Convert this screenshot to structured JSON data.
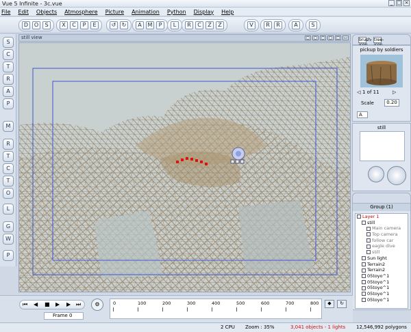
{
  "window": {
    "title": "Vue 5 Infinite - 3c.vue",
    "controls": [
      "_",
      "□",
      "×"
    ]
  },
  "menu": [
    "File",
    "Edit",
    "Objects",
    "Atmosphere",
    "Picture",
    "Animation",
    "Python",
    "Display",
    "Help"
  ],
  "toolbar": {
    "groups": [
      [
        "D",
        "O",
        "S"
      ],
      [
        "X",
        "C",
        "P",
        "E"
      ],
      [
        "↺",
        "↻"
      ],
      [
        "A",
        "M",
        "P"
      ],
      [
        "L"
      ],
      [
        "R",
        "C",
        "Z",
        "Z"
      ],
      [
        "V"
      ],
      [
        "R",
        "R"
      ],
      [
        "A"
      ],
      [
        "S"
      ]
    ]
  },
  "left_tools": [
    "S",
    "C",
    "T",
    "R",
    "A",
    "P",
    "M",
    "R",
    "T",
    "C",
    "T",
    "O",
    "L",
    "G",
    "W",
    "P",
    "E"
  ],
  "viewport": {
    "title": "still view",
    "header_icons": [
      "▢",
      "▢",
      "▢",
      "▢",
      "□",
      "▭"
    ]
  },
  "right_panel": {
    "tab_icons": [
      "brush-icon",
      "tree-icon"
    ],
    "preview_title": "pickup by soldiers",
    "pager": "1 of 11",
    "scale_label": "Scale",
    "scale_value": "0.20",
    "mode_select": "A",
    "camera_box_title": "still",
    "group_title": "Group (1)",
    "layer": "Layer 1",
    "tree": [
      {
        "label": "still",
        "indent": 1
      },
      {
        "label": "Main camera",
        "indent": 2
      },
      {
        "label": "Top camera",
        "indent": 2
      },
      {
        "label": "follow car",
        "indent": 2
      },
      {
        "label": "eagle dive",
        "indent": 2
      },
      {
        "label": "still",
        "indent": 2
      },
      {
        "label": "Sun light",
        "indent": 1
      },
      {
        "label": "Terrain2",
        "indent": 1
      },
      {
        "label": "Terrain2",
        "indent": 1
      },
      {
        "label": "05toyo^1",
        "indent": 1
      },
      {
        "label": "05toyo^1",
        "indent": 1
      },
      {
        "label": "05toyo^1",
        "indent": 1
      },
      {
        "label": "05toyo^1",
        "indent": 1
      },
      {
        "label": "05toyo^1",
        "indent": 1
      }
    ]
  },
  "timeline": {
    "frame_label": "Frame 0",
    "ticks": [
      "0",
      "100",
      "200",
      "300",
      "400",
      "500",
      "600",
      "700",
      "800"
    ]
  },
  "status": {
    "cpu": "2 CPU",
    "zoom": "Zoom : 35%",
    "objects": "3,041 objects - 1 lights",
    "polygons": "12,546,992 polygons"
  },
  "colors": {
    "accent": "#3b56d6",
    "objects_text": "#d01010"
  }
}
